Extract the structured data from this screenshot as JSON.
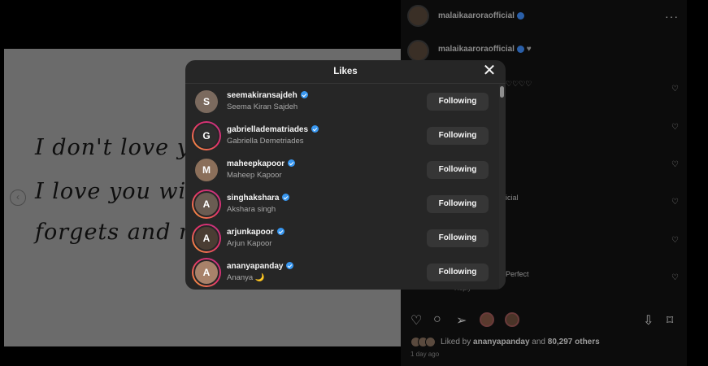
{
  "background": {
    "post_lines": [
      "I don't love you w",
      "I love you with m",
      "forgets and my n"
    ],
    "prev_arrow_icon": "chevron-left-icon"
  },
  "right_panel": {
    "owner": "malaikaaroraofficial",
    "caption_user": "malaikaaroraofficial",
    "fragments": [
      "♡♡♡♡",
      "icial",
      "Perfect",
      "Reply"
    ]
  },
  "modal": {
    "title": "Likes",
    "close_icon": "close-icon",
    "users": [
      {
        "username": "seemakiransajdeh",
        "full_name": "Seema Kiran Sajdeh",
        "button": "Following",
        "story": false,
        "initials": "S",
        "color": "#7b6a5e"
      },
      {
        "username": "gabrielladematriades",
        "full_name": "Gabriella Demetriades",
        "button": "Following",
        "story": true,
        "initials": "G",
        "color": "#2d2d2d"
      },
      {
        "username": "maheepkapoor",
        "full_name": "Maheep Kapoor",
        "button": "Following",
        "story": false,
        "initials": "M",
        "color": "#8b6f5a"
      },
      {
        "username": "singhakshara",
        "full_name": "Akshara singh",
        "button": "Following",
        "story": true,
        "initials": "A",
        "color": "#6a5c52"
      },
      {
        "username": "arjunkapoor",
        "full_name": "Arjun Kapoor",
        "button": "Following",
        "story": true,
        "initials": "A",
        "color": "#4a3d33"
      },
      {
        "username": "ananyapanday",
        "full_name": "Ananya 🌙",
        "button": "Following",
        "story": true,
        "initials": "A",
        "color": "#a8826a"
      }
    ]
  },
  "footer": {
    "liked_prefix": "Liked by ",
    "liked_user": "ananyapanday",
    "liked_mid": " and ",
    "liked_count": "80,297 others",
    "time": "1 day ago"
  }
}
